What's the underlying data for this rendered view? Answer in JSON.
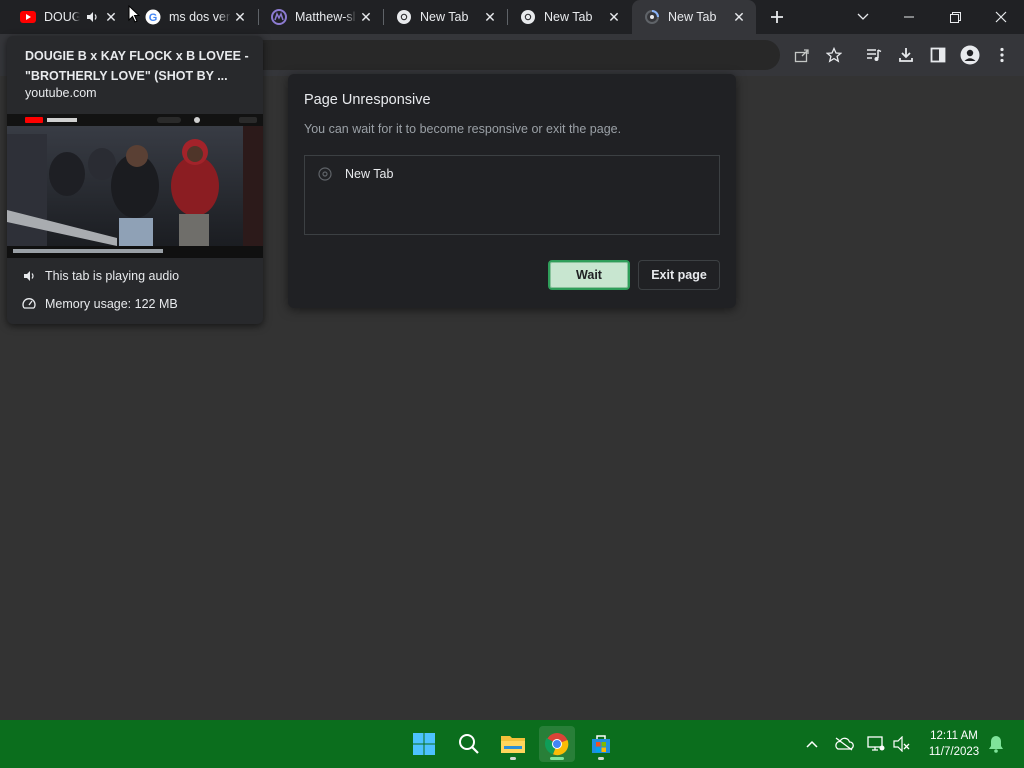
{
  "tabs": [
    {
      "title": "DOUGIE B x KAY FLOCK x B LOVEE",
      "favicon": "youtube-icon",
      "audio": true
    },
    {
      "title": "ms dos ver",
      "favicon": "google-icon"
    },
    {
      "title": "Matthew-sl",
      "favicon": "app-icon"
    },
    {
      "title": "New Tab",
      "favicon": "chrome-icon"
    },
    {
      "title": "New Tab",
      "favicon": "chrome-icon"
    },
    {
      "title": "New Tab",
      "favicon": "chrome-icon",
      "active": true
    }
  ],
  "hovercard": {
    "title": "DOUGIE B x KAY FLOCK x B LOVEE - \"BROTHERLY LOVE\" (SHOT BY ...",
    "domain": "youtube.com",
    "audio_status": "This tab is playing audio",
    "memory": "Memory usage: 122 MB"
  },
  "dialog": {
    "title": "Page Unresponsive",
    "message": "You can wait for it to become responsive or exit the page.",
    "item": "New Tab",
    "wait_label": "Wait",
    "exit_label": "Exit page"
  },
  "taskbar": {
    "time": "12:11 AM",
    "date": "11/7/2023",
    "apps": [
      "start-icon",
      "search-icon",
      "file-explorer-icon",
      "chrome-icon",
      "store-icon"
    ]
  },
  "colors": {
    "taskbar": "#0b6e1d",
    "page_bg": "#333333",
    "dialog_bg": "#202124",
    "wait_button": "#c8e6d0",
    "tabstrip": "#202124"
  }
}
